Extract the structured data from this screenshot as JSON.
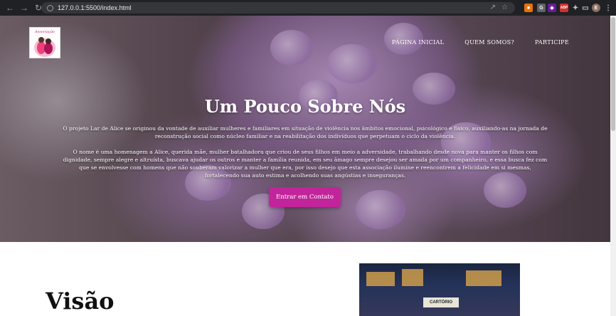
{
  "browser": {
    "url": "127.0.0.1:5500/index.html",
    "extensions": [
      "G",
      "ABP",
      "E"
    ]
  },
  "logo": {
    "text": "Associação"
  },
  "nav": {
    "items": [
      "PÁGINA INICIAL",
      "QUEM SOMOS?",
      "PARTICIPE"
    ]
  },
  "hero": {
    "title": "Um Pouco Sobre Nós",
    "paragraph1": "O projeto Lar de Alice se originou da vontade de auxiliar mulheres e familiares em situação de violência nos âmbitos emocional, psicológico e físico, auxiliando-as na jornada de reconstrução social como núcleo familiar e na reabilitação dos indivíduos que perpetuam o ciclo da violência.",
    "paragraph2": "O nome é uma homenagem a Alice, querida mãe, mulher batalhadora que criou de seus filhos em meio a adversidade, trabalhando desde nova para manter os filhos com dignidade, sempre alegre e altruísta, buscava ajudar os outros e manter a família reunida, em seu âmago sempre desejou ser amada por um companheiro, e essa busca fez com que se envolvesse com homens que não souberam valorizar a mulher que era, por isso desejo que esta associação ilumine e reencontrem a felicidade em si mesmas, fortalecendo sua auto estima e acolhendo suas angústias e inseguranças.",
    "cta_label": "Entrar em Contato"
  },
  "section": {
    "title": "Visão"
  },
  "photo": {
    "sign_text": "CARTÓRIO"
  },
  "colors": {
    "accent": "#c2249b",
    "chrome": "#202124"
  }
}
